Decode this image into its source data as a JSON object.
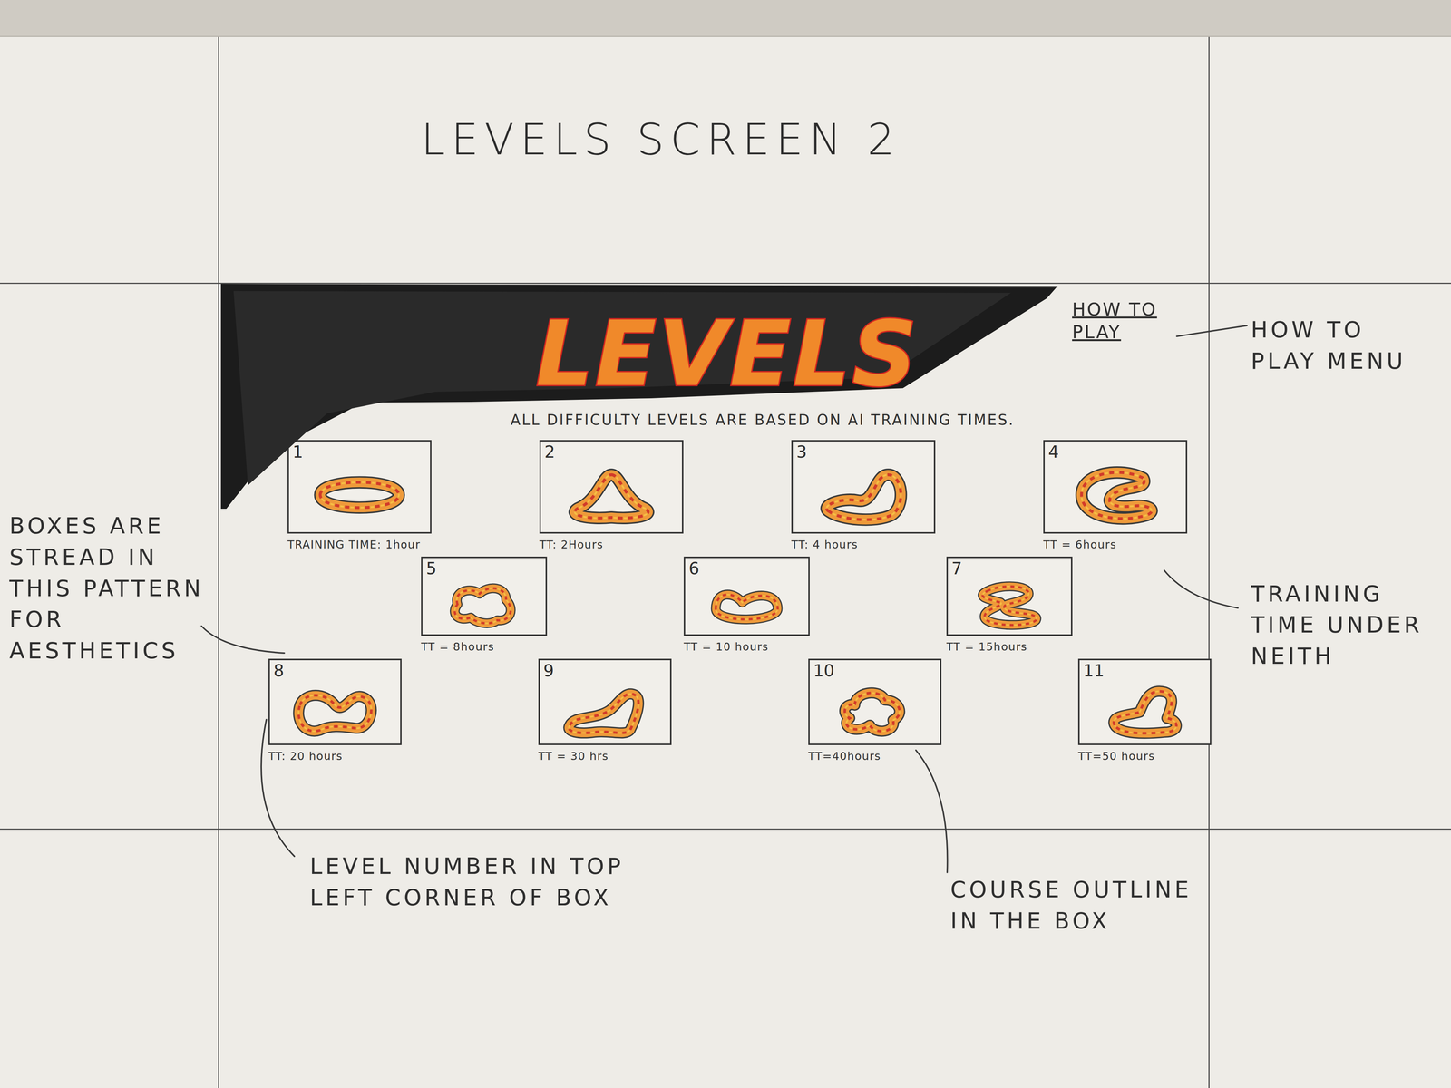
{
  "page_title": "LEVELS SCREEN 2",
  "header": {
    "title": "LEVELS",
    "subtitle": "ALL DIFFICULTY LEVELS ARE BASED ON AI TRAINING TIMES.",
    "how_to_play": "HOW TO PLAY"
  },
  "levels": [
    {
      "number": "1",
      "training_time": "TRAINING TIME: 1hour"
    },
    {
      "number": "2",
      "training_time": "TT: 2Hours"
    },
    {
      "number": "3",
      "training_time": "TT: 4 hours"
    },
    {
      "number": "4",
      "training_time": "TT = 6hours"
    },
    {
      "number": "5",
      "training_time": "TT = 8hours"
    },
    {
      "number": "6",
      "training_time": "TT = 10 hours"
    },
    {
      "number": "7",
      "training_time": "TT = 15hours"
    },
    {
      "number": "8",
      "training_time": "TT: 20 hours"
    },
    {
      "number": "9",
      "training_time": "TT = 30 hrs"
    },
    {
      "number": "10",
      "training_time": "TT=40hours"
    },
    {
      "number": "11",
      "training_time": "TT=50 hours"
    }
  ],
  "annotations": {
    "how_to_play": "HOW TO PLAY MENU",
    "boxes": "BOXES ARE STREAD IN THIS PATTERN FOR AESTHETICS",
    "training_time": "TRAINING TIME UNDER NEITH",
    "level_number": "LEVEL NUMBER IN TOP LEFT CORNER OF BOX",
    "course_outline": "COURSE OUTLINE IN THE BOX"
  }
}
